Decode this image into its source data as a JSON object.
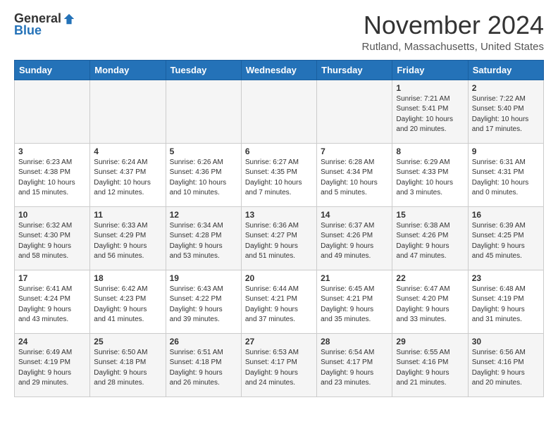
{
  "logo": {
    "general": "General",
    "blue": "Blue"
  },
  "title": "November 2024",
  "location": "Rutland, Massachusetts, United States",
  "days_header": [
    "Sunday",
    "Monday",
    "Tuesday",
    "Wednesday",
    "Thursday",
    "Friday",
    "Saturday"
  ],
  "weeks": [
    [
      {
        "num": "",
        "info": ""
      },
      {
        "num": "",
        "info": ""
      },
      {
        "num": "",
        "info": ""
      },
      {
        "num": "",
        "info": ""
      },
      {
        "num": "",
        "info": ""
      },
      {
        "num": "1",
        "info": "Sunrise: 7:21 AM\nSunset: 5:41 PM\nDaylight: 10 hours\nand 20 minutes."
      },
      {
        "num": "2",
        "info": "Sunrise: 7:22 AM\nSunset: 5:40 PM\nDaylight: 10 hours\nand 17 minutes."
      }
    ],
    [
      {
        "num": "3",
        "info": "Sunrise: 6:23 AM\nSunset: 4:38 PM\nDaylight: 10 hours\nand 15 minutes."
      },
      {
        "num": "4",
        "info": "Sunrise: 6:24 AM\nSunset: 4:37 PM\nDaylight: 10 hours\nand 12 minutes."
      },
      {
        "num": "5",
        "info": "Sunrise: 6:26 AM\nSunset: 4:36 PM\nDaylight: 10 hours\nand 10 minutes."
      },
      {
        "num": "6",
        "info": "Sunrise: 6:27 AM\nSunset: 4:35 PM\nDaylight: 10 hours\nand 7 minutes."
      },
      {
        "num": "7",
        "info": "Sunrise: 6:28 AM\nSunset: 4:34 PM\nDaylight: 10 hours\nand 5 minutes."
      },
      {
        "num": "8",
        "info": "Sunrise: 6:29 AM\nSunset: 4:33 PM\nDaylight: 10 hours\nand 3 minutes."
      },
      {
        "num": "9",
        "info": "Sunrise: 6:31 AM\nSunset: 4:31 PM\nDaylight: 10 hours\nand 0 minutes."
      }
    ],
    [
      {
        "num": "10",
        "info": "Sunrise: 6:32 AM\nSunset: 4:30 PM\nDaylight: 9 hours\nand 58 minutes."
      },
      {
        "num": "11",
        "info": "Sunrise: 6:33 AM\nSunset: 4:29 PM\nDaylight: 9 hours\nand 56 minutes."
      },
      {
        "num": "12",
        "info": "Sunrise: 6:34 AM\nSunset: 4:28 PM\nDaylight: 9 hours\nand 53 minutes."
      },
      {
        "num": "13",
        "info": "Sunrise: 6:36 AM\nSunset: 4:27 PM\nDaylight: 9 hours\nand 51 minutes."
      },
      {
        "num": "14",
        "info": "Sunrise: 6:37 AM\nSunset: 4:26 PM\nDaylight: 9 hours\nand 49 minutes."
      },
      {
        "num": "15",
        "info": "Sunrise: 6:38 AM\nSunset: 4:26 PM\nDaylight: 9 hours\nand 47 minutes."
      },
      {
        "num": "16",
        "info": "Sunrise: 6:39 AM\nSunset: 4:25 PM\nDaylight: 9 hours\nand 45 minutes."
      }
    ],
    [
      {
        "num": "17",
        "info": "Sunrise: 6:41 AM\nSunset: 4:24 PM\nDaylight: 9 hours\nand 43 minutes."
      },
      {
        "num": "18",
        "info": "Sunrise: 6:42 AM\nSunset: 4:23 PM\nDaylight: 9 hours\nand 41 minutes."
      },
      {
        "num": "19",
        "info": "Sunrise: 6:43 AM\nSunset: 4:22 PM\nDaylight: 9 hours\nand 39 minutes."
      },
      {
        "num": "20",
        "info": "Sunrise: 6:44 AM\nSunset: 4:21 PM\nDaylight: 9 hours\nand 37 minutes."
      },
      {
        "num": "21",
        "info": "Sunrise: 6:45 AM\nSunset: 4:21 PM\nDaylight: 9 hours\nand 35 minutes."
      },
      {
        "num": "22",
        "info": "Sunrise: 6:47 AM\nSunset: 4:20 PM\nDaylight: 9 hours\nand 33 minutes."
      },
      {
        "num": "23",
        "info": "Sunrise: 6:48 AM\nSunset: 4:19 PM\nDaylight: 9 hours\nand 31 minutes."
      }
    ],
    [
      {
        "num": "24",
        "info": "Sunrise: 6:49 AM\nSunset: 4:19 PM\nDaylight: 9 hours\nand 29 minutes."
      },
      {
        "num": "25",
        "info": "Sunrise: 6:50 AM\nSunset: 4:18 PM\nDaylight: 9 hours\nand 28 minutes."
      },
      {
        "num": "26",
        "info": "Sunrise: 6:51 AM\nSunset: 4:18 PM\nDaylight: 9 hours\nand 26 minutes."
      },
      {
        "num": "27",
        "info": "Sunrise: 6:53 AM\nSunset: 4:17 PM\nDaylight: 9 hours\nand 24 minutes."
      },
      {
        "num": "28",
        "info": "Sunrise: 6:54 AM\nSunset: 4:17 PM\nDaylight: 9 hours\nand 23 minutes."
      },
      {
        "num": "29",
        "info": "Sunrise: 6:55 AM\nSunset: 4:16 PM\nDaylight: 9 hours\nand 21 minutes."
      },
      {
        "num": "30",
        "info": "Sunrise: 6:56 AM\nSunset: 4:16 PM\nDaylight: 9 hours\nand 20 minutes."
      }
    ]
  ]
}
